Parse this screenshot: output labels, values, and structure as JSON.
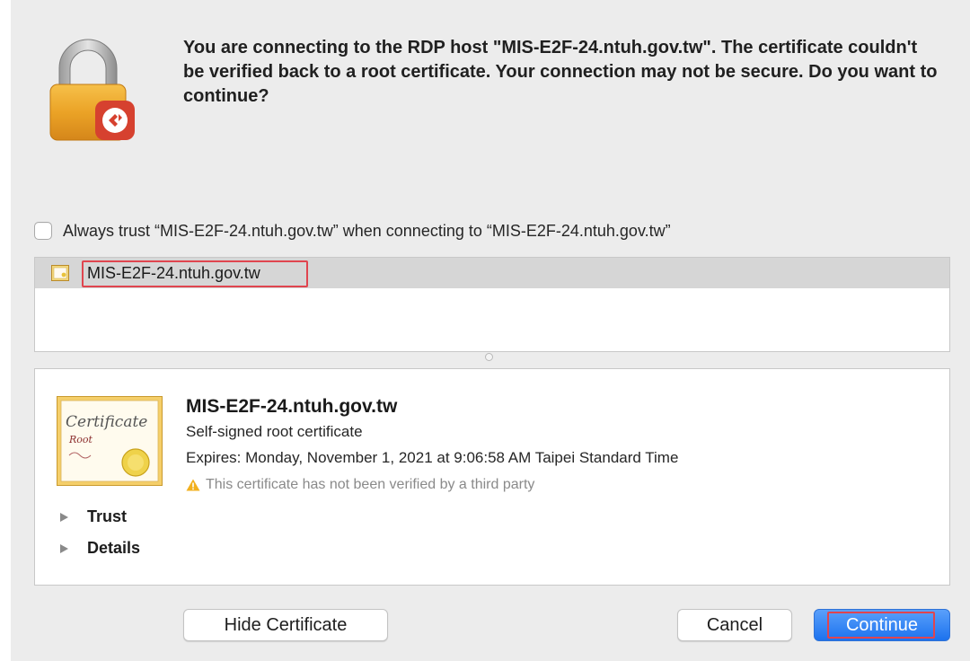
{
  "dialog": {
    "message": "You are connecting to the RDP host \"MIS-E2F-24.ntuh.gov.tw\". The certificate couldn't be verified back to a root certificate. Your connection may not be secure. Do you want to continue?",
    "always_trust_label": "Always trust “MIS-E2F-24.ntuh.gov.tw” when connecting to “MIS-E2F-24.ntuh.gov.tw”",
    "always_trust_checked": false
  },
  "certificate_list": {
    "items": [
      {
        "label": "MIS-E2F-24.ntuh.gov.tw",
        "icon": "certificate-icon",
        "selected": true
      }
    ]
  },
  "certificate_detail": {
    "title": "MIS-E2F-24.ntuh.gov.tw",
    "kind": "Self-signed root certificate",
    "expires": "Expires: Monday, November 1, 2021 at 9:06:58 AM Taipei Standard Time",
    "warning": "This certificate has not been verified by a third party",
    "image_text": [
      "Certificate",
      "Root"
    ],
    "sections": [
      "Trust",
      "Details"
    ]
  },
  "buttons": {
    "hide_certificate": "Hide Certificate",
    "cancel": "Cancel",
    "continue": "Continue"
  },
  "colors": {
    "accent": "#1c72ee",
    "highlight": "#e0454f",
    "warning": "#f2b01e"
  }
}
